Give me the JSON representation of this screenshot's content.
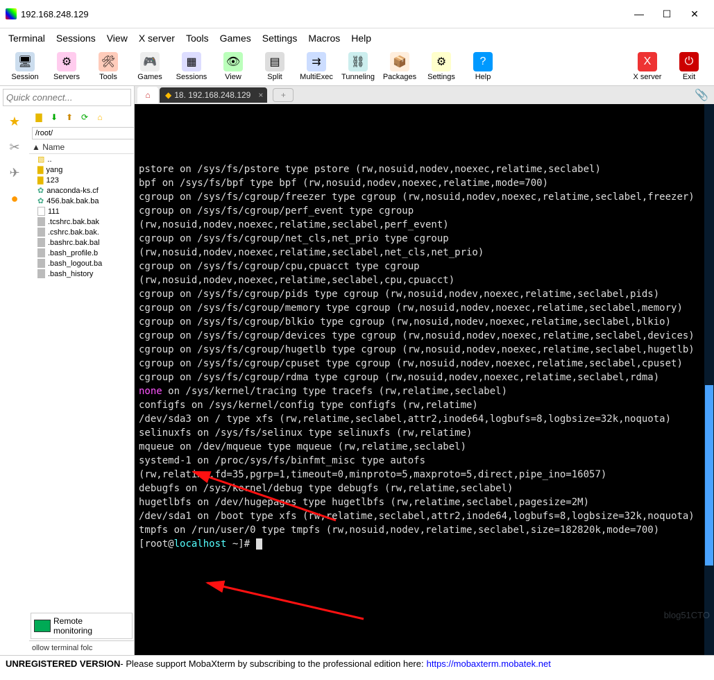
{
  "window": {
    "title": "192.168.248.129"
  },
  "menubar": [
    "Terminal",
    "Sessions",
    "View",
    "X server",
    "Tools",
    "Games",
    "Settings",
    "Macros",
    "Help"
  ],
  "toolbar": [
    {
      "label": "Session",
      "cls": "ic-session",
      "glyph": "🖥"
    },
    {
      "label": "Servers",
      "cls": "ic-servers",
      "glyph": "⚙"
    },
    {
      "label": "Tools",
      "cls": "ic-tools",
      "glyph": "🛠"
    },
    {
      "label": "Games",
      "cls": "ic-games",
      "glyph": "🎮"
    },
    {
      "label": "Sessions",
      "cls": "ic-sessions",
      "glyph": "▦"
    },
    {
      "label": "View",
      "cls": "ic-view",
      "glyph": "👁"
    },
    {
      "label": "Split",
      "cls": "ic-split",
      "glyph": "▤"
    },
    {
      "label": "MultiExec",
      "cls": "ic-multi",
      "glyph": "⇉"
    },
    {
      "label": "Tunneling",
      "cls": "ic-tunnel",
      "glyph": "⛓"
    },
    {
      "label": "Packages",
      "cls": "ic-pkg",
      "glyph": "📦"
    },
    {
      "label": "Settings",
      "cls": "ic-settings",
      "glyph": "⚙"
    },
    {
      "label": "Help",
      "cls": "ic-help",
      "glyph": "?"
    }
  ],
  "toolbar_right": [
    {
      "label": "X server",
      "cls": "ic-x",
      "glyph": "X"
    },
    {
      "label": "Exit",
      "cls": "ic-exit",
      "glyph": "⏻"
    }
  ],
  "sidebar": {
    "quick_connect": "Quick connect...",
    "path": "/root/",
    "name_header": "Name",
    "files": [
      {
        "type": "up",
        "label": ".."
      },
      {
        "type": "folder",
        "label": "yang"
      },
      {
        "type": "folder",
        "label": "123"
      },
      {
        "type": "sys",
        "label": "anaconda-ks.cf"
      },
      {
        "type": "sys",
        "label": "456.bak.bak.ba"
      },
      {
        "type": "file",
        "label": "111"
      },
      {
        "type": "gray",
        "label": ".tcshrc.bak.bak"
      },
      {
        "type": "gray",
        "label": ".cshrc.bak.bak."
      },
      {
        "type": "gray",
        "label": ".bashrc.bak.bal"
      },
      {
        "type": "gray",
        "label": ".bash_profile.b"
      },
      {
        "type": "gray",
        "label": ".bash_logout.ba"
      },
      {
        "type": "gray",
        "label": ".bash_history"
      }
    ],
    "remote_mon_l1": "Remote",
    "remote_mon_l2": "monitoring",
    "follow": "ollow terminal folc"
  },
  "tab": {
    "label": "18. 192.168.248.129"
  },
  "terminal_lines": [
    "pstore on /sys/fs/pstore type pstore (rw,nosuid,nodev,noexec,relatime,seclabel)",
    "bpf on /sys/fs/bpf type bpf (rw,nosuid,nodev,noexec,relatime,mode=700)",
    "cgroup on /sys/fs/cgroup/freezer type cgroup (rw,nosuid,nodev,noexec,relatime,seclabel,freezer)",
    "cgroup on /sys/fs/cgroup/perf_event type cgroup (rw,nosuid,nodev,noexec,relatime,seclabel,perf_event)",
    "cgroup on /sys/fs/cgroup/net_cls,net_prio type cgroup (rw,nosuid,nodev,noexec,relatime,seclabel,net_cls,net_prio)",
    "cgroup on /sys/fs/cgroup/cpu,cpuacct type cgroup (rw,nosuid,nodev,noexec,relatime,seclabel,cpu,cpuacct)",
    "cgroup on /sys/fs/cgroup/pids type cgroup (rw,nosuid,nodev,noexec,relatime,seclabel,pids)",
    "cgroup on /sys/fs/cgroup/memory type cgroup (rw,nosuid,nodev,noexec,relatime,seclabel,memory)",
    "cgroup on /sys/fs/cgroup/blkio type cgroup (rw,nosuid,nodev,noexec,relatime,seclabel,blkio)",
    "cgroup on /sys/fs/cgroup/devices type cgroup (rw,nosuid,nodev,noexec,relatime,seclabel,devices)",
    "cgroup on /sys/fs/cgroup/hugetlb type cgroup (rw,nosuid,nodev,noexec,relatime,seclabel,hugetlb)",
    "cgroup on /sys/fs/cgroup/cpuset type cgroup (rw,nosuid,nodev,noexec,relatime,seclabel,cpuset)",
    "cgroup on /sys/fs/cgroup/rdma type cgroup (rw,nosuid,nodev,noexec,relatime,seclabel,rdma)"
  ],
  "terminal_none_line": {
    "none": "none",
    "rest": " on /sys/kernel/tracing type tracefs (rw,relatime,seclabel)"
  },
  "terminal_lines2": [
    "configfs on /sys/kernel/config type configfs (rw,relatime)",
    "/dev/sda3 on / type xfs (rw,relatime,seclabel,attr2,inode64,logbufs=8,logbsize=32k,noquota)",
    "selinuxfs on /sys/fs/selinux type selinuxfs (rw,relatime)",
    "mqueue on /dev/mqueue type mqueue (rw,relatime,seclabel)",
    "systemd-1 on /proc/sys/fs/binfmt_misc type autofs (rw,relatime,fd=35,pgrp=1,timeout=0,minproto=5,maxproto=5,direct,pipe_ino=16057)",
    "debugfs on /sys/kernel/debug type debugfs (rw,relatime,seclabel)",
    "hugetlbfs on /dev/hugepages type hugetlbfs (rw,relatime,seclabel,pagesize=2M)",
    "/dev/sda1 on /boot type xfs (rw,relatime,seclabel,attr2,inode64,logbufs=8,logbsize=32k,noquota)",
    "tmpfs on /run/user/0 type tmpfs (rw,nosuid,nodev,relatime,seclabel,size=182820k,mode=700)"
  ],
  "prompt": {
    "open": "[",
    "user": "root@",
    "host": "localhost",
    "rest": " ~]# "
  },
  "footer": {
    "unreg": "UNREGISTERED VERSION",
    "msg": "  -  Please support MobaXterm by subscribing to the professional edition here:",
    "url": "https://mobaxterm.mobatek.net"
  }
}
